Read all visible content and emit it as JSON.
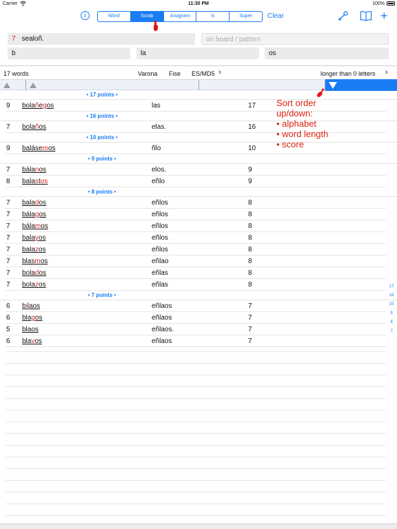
{
  "status": {
    "carrier": "Carrier",
    "time": "11:30 PM",
    "battery": "100%"
  },
  "toolbar": {
    "info_icon": "info-icon",
    "segments": [
      "Word",
      "Scrab",
      "Anagram",
      "Is",
      "Super"
    ],
    "active_segment": "Scrab",
    "clear_label": "Clear",
    "icons": [
      "wrench-icon",
      "book-icon",
      "plus-icon"
    ]
  },
  "fields": {
    "letters_count": "7",
    "letters": "sealoñ.",
    "board_placeholder": "on board / pattern",
    "prefix": "b",
    "middle": "la",
    "suffix": "os"
  },
  "info": {
    "word_count": "17 words",
    "dict1": "Varona",
    "dict2": "Fise",
    "dict3": "ES/MD5",
    "length_filter": "longer than 0 letters"
  },
  "groups": [
    {
      "header": "• 17 points •",
      "rows": [
        {
          "len": "9",
          "word": [
            "bola",
            "ñ",
            "e",
            "g",
            "os"
          ],
          "pattern": "las",
          "score": "17"
        }
      ]
    },
    {
      "header": "• 16 points •",
      "rows": [
        {
          "len": "7",
          "word": [
            "bola",
            "ñ",
            "os"
          ],
          "pattern": "elas.",
          "score": "16"
        }
      ]
    },
    {
      "header": "• 10 points •",
      "rows": [
        {
          "len": "9",
          "word": [
            "baláse",
            "m",
            "os"
          ],
          "pattern": "ñlo",
          "score": "10"
        }
      ]
    },
    {
      "header": "• 9 points •",
      "rows": [
        {
          "len": "7",
          "word": [
            "bála",
            "n",
            "os"
          ],
          "pattern": "elos.",
          "score": "9"
        },
        {
          "len": "8",
          "word": [
            "bala",
            "s",
            "t",
            "os"
          ],
          "pattern": "eñlo",
          "score": "9"
        }
      ]
    },
    {
      "header": "• 8 points •",
      "rows": [
        {
          "len": "7",
          "word": [
            "bala",
            "d",
            "os"
          ],
          "pattern": "eñlos",
          "score": "8"
        },
        {
          "len": "7",
          "word": [
            "bála",
            "g",
            "os"
          ],
          "pattern": "eñlos",
          "score": "8"
        },
        {
          "len": "7",
          "word": [
            "bála",
            "m",
            "os"
          ],
          "pattern": "eñlos",
          "score": "8"
        },
        {
          "len": "7",
          "word": [
            "bala",
            "y",
            "os"
          ],
          "pattern": "eñlos",
          "score": "8"
        },
        {
          "len": "7",
          "word": [
            "bala",
            "z",
            "os"
          ],
          "pattern": "eñlos",
          "score": "8"
        },
        {
          "len": "7",
          "word": [
            "blas",
            "m",
            "os"
          ],
          "pattern": "eñlao",
          "score": "8"
        },
        {
          "len": "7",
          "word": [
            "bola",
            "d",
            "os"
          ],
          "pattern": "eñlas",
          "score": "8"
        },
        {
          "len": "7",
          "word": [
            "bola",
            "z",
            "os"
          ],
          "pattern": "eñlas",
          "score": "8"
        }
      ]
    },
    {
      "header": "• 7 points •",
      "rows": [
        {
          "len": "6",
          "word": [
            "b",
            "i",
            "laos"
          ],
          "pattern": "eñlaos",
          "score": "7"
        },
        {
          "len": "6",
          "word": [
            "bla",
            "g",
            "os"
          ],
          "pattern": "eñlaos",
          "score": "7"
        },
        {
          "len": "5",
          "word": [
            "blaos"
          ],
          "pattern": "eñlaos.",
          "score": "7"
        },
        {
          "len": "6",
          "word": [
            "bla",
            "v",
            "os"
          ],
          "pattern": "eñlaos",
          "score": "7"
        }
      ]
    }
  ],
  "annotation": {
    "lines": [
      "Sort order",
      "up/down:",
      "• alphabet",
      "• word length",
      "• score"
    ]
  },
  "index_bar": [
    "17",
    "16",
    "10",
    "9",
    "8",
    "7"
  ],
  "colors": {
    "accent": "#1a7cf5",
    "highlight": "#dd2222"
  }
}
